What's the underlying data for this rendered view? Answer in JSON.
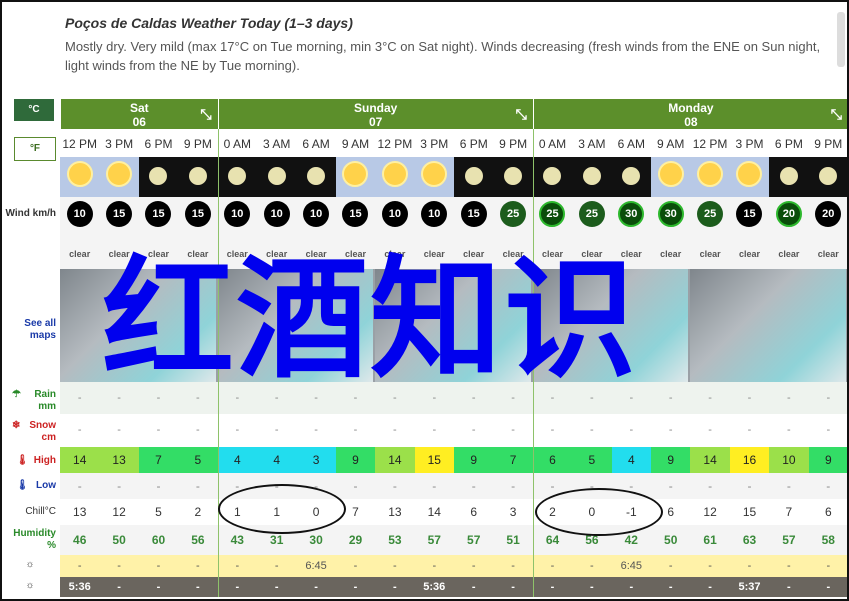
{
  "header": {
    "title": "Poços de Caldas Weather Today (1–3 days)",
    "description": "Mostly dry. Very mild (max 17°C on Tue morning, min 3°C on Sat night). Winds decreasing (fresh winds from the ENE on Sun night, light winds from the NE by Tue morning)."
  },
  "units": {
    "celsius": "°C",
    "fahrenheit": "°F"
  },
  "labels": {
    "wind": "Wind km/h",
    "maps": "See all maps",
    "rain": "Rain mm",
    "snow": "Snow cm",
    "high": "High",
    "low": "Low",
    "chill": "Chill°C",
    "humidity": "Humidity %"
  },
  "days": [
    {
      "name": "Sat",
      "date": "06"
    },
    {
      "name": "Sunday",
      "date": "07"
    },
    {
      "name": "Monday",
      "date": "08"
    }
  ],
  "times": [
    "12 PM",
    "3 PM",
    "6 PM",
    "9 PM",
    "0 AM",
    "3 AM",
    "6 AM",
    "9 AM",
    "12 PM",
    "3 PM",
    "6 PM",
    "9 PM",
    "0 AM",
    "3 AM",
    "6 AM",
    "9 AM",
    "12 PM",
    "3 PM",
    "6 PM",
    "9 PM"
  ],
  "icons": [
    "sun",
    "sun",
    "moon",
    "moon",
    "moon",
    "moon",
    "moon",
    "sun",
    "sun",
    "sun",
    "moon",
    "moon",
    "moon",
    "moon",
    "moon",
    "sun",
    "sun",
    "sun",
    "moon",
    "moon"
  ],
  "wind": [
    "10",
    "15",
    "15",
    "15",
    "10",
    "10",
    "10",
    "15",
    "10",
    "10",
    "15",
    "25",
    "25",
    "25",
    "30",
    "30",
    "25",
    "15",
    "20",
    "20"
  ],
  "wind_style": [
    "k",
    "k",
    "k",
    "k",
    "k",
    "k",
    "k",
    "k",
    "k",
    "k",
    "k",
    "g",
    "gg",
    "g",
    "gg",
    "gg",
    "g",
    "k",
    "gg",
    "k"
  ],
  "conditions": [
    "clear",
    "clear",
    "clear",
    "clear",
    "clear",
    "clear",
    "clear",
    "clear",
    "clear",
    "clear",
    "clear",
    "clear",
    "clear",
    "clear",
    "clear",
    "clear",
    "clear",
    "clear",
    "clear",
    "clear"
  ],
  "rain": [
    "-",
    "-",
    "-",
    "-",
    "-",
    "-",
    "-",
    "-",
    "-",
    "-",
    "-",
    "-",
    "-",
    "-",
    "-",
    "-",
    "-",
    "-",
    "-",
    "-"
  ],
  "snow": [
    "-",
    "-",
    "-",
    "-",
    "-",
    "-",
    "-",
    "-",
    "-",
    "-",
    "-",
    "-",
    "-",
    "-",
    "-",
    "-",
    "-",
    "-",
    "-",
    "-"
  ],
  "high": [
    "14",
    "13",
    "7",
    "5",
    "4",
    "4",
    "3",
    "9",
    "14",
    "15",
    "9",
    "7",
    "6",
    "5",
    "4",
    "9",
    "14",
    "16",
    "10",
    "9"
  ],
  "high_colors": [
    "#9be04a",
    "#9be04a",
    "#33dd66",
    "#33dd66",
    "#22ddee",
    "#22ddee",
    "#22ddee",
    "#33dd66",
    "#9be04a",
    "#ffee22",
    "#33dd66",
    "#33dd66",
    "#33dd66",
    "#33dd66",
    "#22ddee",
    "#33dd66",
    "#9be04a",
    "#ffee22",
    "#9be04a",
    "#33dd66"
  ],
  "low": [
    "-",
    "-",
    "-",
    "-",
    "-",
    "-",
    "-",
    "-",
    "-",
    "-",
    "-",
    "-",
    "-",
    "-",
    "-",
    "-",
    "-",
    "-",
    "-",
    "-"
  ],
  "chill": [
    "13",
    "12",
    "5",
    "2",
    "1",
    "1",
    "0",
    "7",
    "13",
    "14",
    "6",
    "3",
    "2",
    "0",
    "-1",
    "6",
    "12",
    "15",
    "7",
    "6"
  ],
  "humidity": [
    "46",
    "50",
    "60",
    "56",
    "43",
    "31",
    "30",
    "29",
    "53",
    "57",
    "57",
    "51",
    "64",
    "56",
    "42",
    "50",
    "61",
    "63",
    "57",
    "58"
  ],
  "sunrise": [
    "-",
    "-",
    "-",
    "-",
    "-",
    "-",
    "6:45",
    "-",
    "-",
    "-",
    "-",
    "-",
    "-",
    "-",
    "6:45",
    "-",
    "-",
    "-",
    "-",
    "-"
  ],
  "sunset": [
    "5:36",
    "-",
    "-",
    "-",
    "-",
    "-",
    "-",
    "-",
    "-",
    "5:36",
    "-",
    "-",
    "-",
    "-",
    "-",
    "-",
    "-",
    "5:37",
    "-",
    "-"
  ],
  "overlay_text": "红酒知识",
  "colors": {
    "day_header": "#5c8f2b",
    "unit_active": "#2f6a3a",
    "humidity_text": "#3a8a3a",
    "sunrise_row": "#fff2a8",
    "sunset_row": "#6a655e",
    "overlay": "#0000ee"
  }
}
